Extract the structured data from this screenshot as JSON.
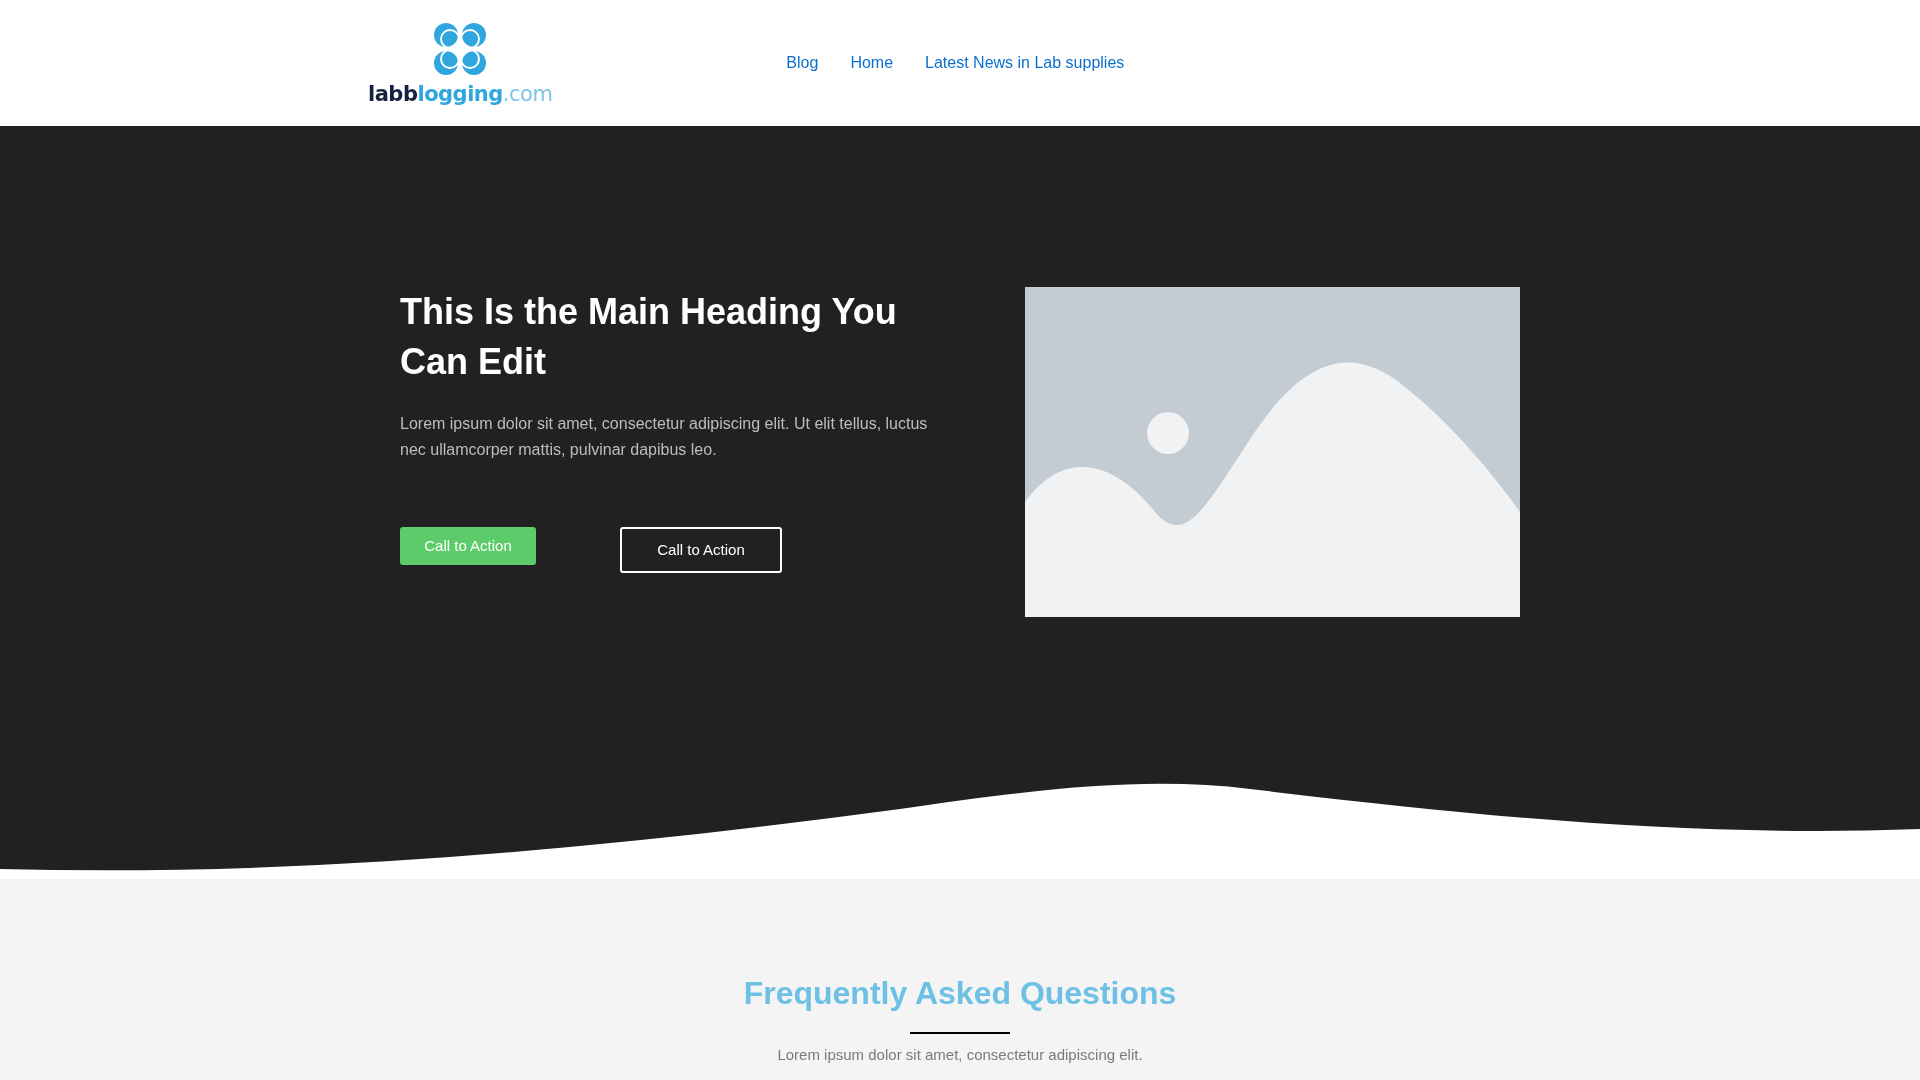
{
  "logo": {
    "parts": [
      "labb",
      "logging",
      ".com"
    ]
  },
  "nav": [
    {
      "label": "Blog"
    },
    {
      "label": "Home"
    },
    {
      "label": "Latest News in Lab supplies"
    }
  ],
  "hero": {
    "heading": "This Is the Main Heading You Can Edit",
    "text": "Lorem ipsum dolor sit amet, consectetur adipiscing elit. Ut elit tellus, luctus nec ullamcorper mattis, pulvinar dapibus leo.",
    "buttons": [
      {
        "label": "Call to Action",
        "kind": "solid"
      },
      {
        "label": "Call to Action",
        "kind": "outline"
      }
    ]
  },
  "faq": {
    "title": "Frequently Asked Questions",
    "text": "Lorem ipsum dolor sit amet, consectetur adipiscing elit."
  }
}
